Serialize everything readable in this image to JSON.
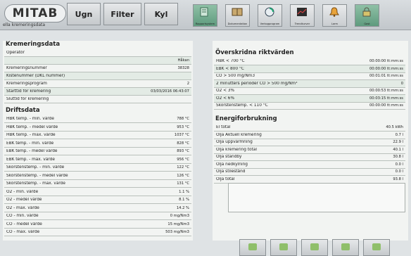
{
  "header": {
    "logo": "MITAB",
    "subtitle": "ella kremeringsdata",
    "tabs": [
      "Ugn",
      "Filter",
      "Kyl"
    ],
    "icons": [
      {
        "name": "report-icon",
        "label": "Rapportsystem"
      },
      {
        "name": "documentation-icon",
        "label": "Dokumentation"
      },
      {
        "name": "programs-icon",
        "label": "Verkogprogram"
      },
      {
        "name": "trend-icon",
        "label": "Trendkurver"
      },
      {
        "name": "alarm-bell-icon",
        "label": "Larm"
      },
      {
        "name": "lock-icon",
        "label": "Gast"
      }
    ]
  },
  "cremation": {
    "title": "Kremeringsdata",
    "rows": [
      {
        "label": "Operatör",
        "value": ""
      },
      {
        "label": "",
        "value": "Håkan"
      },
      {
        "label": "Kremeringsnummer",
        "value": "38328"
      },
      {
        "label": "Kistenummer (DKL nummer)",
        "value": ""
      },
      {
        "label": "Kremeringsprogram",
        "value": "2"
      },
      {
        "label": "Starttid för kremering",
        "value": "03/03/2016 06:43:07"
      },
      {
        "label": "Sluttid för kremering",
        "value": ""
      }
    ]
  },
  "operation": {
    "title": "Driftsdata",
    "rows": [
      {
        "label": "HBK temp. - min. värde",
        "value": "788 °C"
      },
      {
        "label": "HBK temp. - medel värde",
        "value": "953 °C"
      },
      {
        "label": "HBK temp. - max. värde",
        "value": "1037 °C"
      },
      {
        "label": "EBK temp. - min. värde",
        "value": "828 °C"
      },
      {
        "label": "EBK temp. - medel värde",
        "value": "893 °C"
      },
      {
        "label": "EBK temp. - max. värde",
        "value": "956 °C"
      },
      {
        "label": "Skorstenstemp. - min. värde",
        "value": "122 °C"
      },
      {
        "label": "Skorstenstemp. - medel värde",
        "value": "126 °C"
      },
      {
        "label": "Skorstenstemp. - max. värde",
        "value": "131 °C"
      },
      {
        "label": "O2 - min. värde",
        "value": "1.1 %"
      },
      {
        "label": "O2 - medel värde",
        "value": "8.1 %"
      },
      {
        "label": "O2 - max. värde",
        "value": "14.2 %"
      },
      {
        "label": "CO - min. värde",
        "value": "0 mg/Nm3"
      },
      {
        "label": "CO - medel värde",
        "value": "15 mg/Nm3"
      },
      {
        "label": "CO - max. värde",
        "value": "503 mg/Nm3"
      }
    ]
  },
  "limits": {
    "title": "Överskridna riktvärden",
    "rows": [
      {
        "label": "HBK < 700 °C",
        "value": "00:00:00 tt:mm:ss"
      },
      {
        "label": "EBK < 800 °C",
        "value": "00:00:00 tt:mm:ss"
      },
      {
        "label": "CO > 500 mg/Nm3",
        "value": "00:01:01 tt:mm:ss"
      },
      {
        "label": "2 minutters perioder CO > 500 mg/Nm³",
        "value": "0"
      },
      {
        "label": "O2 < 3%",
        "value": "00:00:53 tt:mm:ss"
      },
      {
        "label": "O2 < 6%",
        "value": "00:03:15 tt:mm:ss"
      },
      {
        "label": "Skorstenstemp. < 110 °C",
        "value": "00:00:00 tt:mm:ss"
      }
    ]
  },
  "energy": {
    "title": "Energiforbrukning",
    "rows": [
      {
        "label": "El total",
        "value": "40.5 kWh"
      },
      {
        "label": "Olja Aktuell kremering",
        "value": "0.7 l"
      },
      {
        "label": "Olja uppvärmning",
        "value": "22.9 l"
      },
      {
        "label": "Olja kremering total",
        "value": "40.1 l"
      },
      {
        "label": "Olja standby",
        "value": "30.8 l"
      },
      {
        "label": "Olja nedkylning",
        "value": "0.0 l"
      },
      {
        "label": "Olja stilestånd",
        "value": "0.0 l"
      },
      {
        "label": "Olja total",
        "value": "93.8 l"
      }
    ]
  }
}
